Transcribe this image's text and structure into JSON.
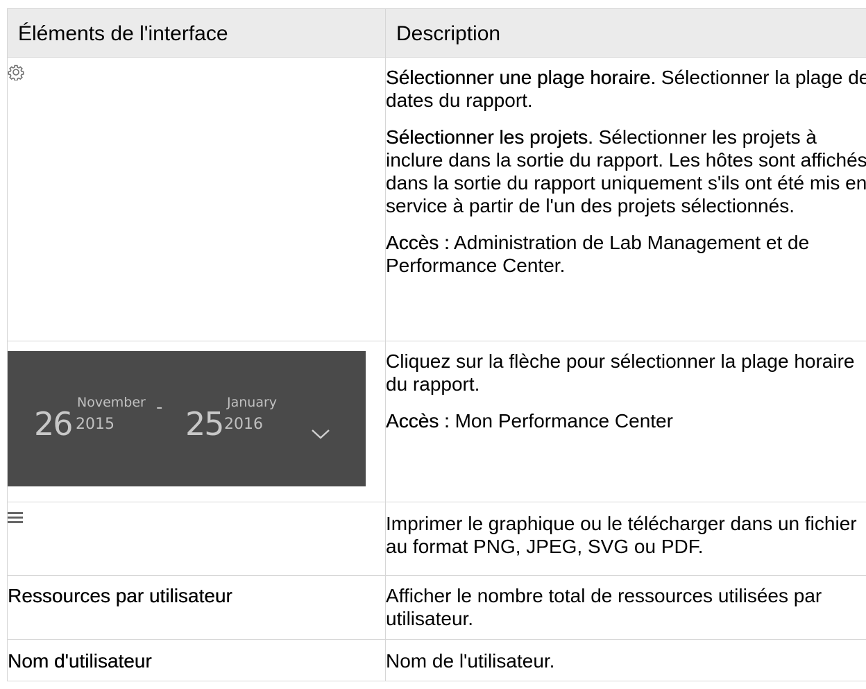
{
  "table": {
    "headers": {
      "col1": "Éléments de l'interface",
      "col2": "Description"
    },
    "rows": [
      {
        "element_icon": "gear-icon",
        "paragraphs": [
          {
            "bold": "Sélectionner une plage horaire.",
            "text": " Sélectionner la plage de dates du rapport."
          },
          {
            "bold": "Sélectionner les projets.",
            "text": " Sélectionner les projets à inclure dans la sortie du rapport. Les hôtes sont affichés dans la sortie du rapport uniquement s'ils ont été mis en service à partir de l'un des projets sélectionnés."
          },
          {
            "bold": "Accès :",
            "text": " Administration de Lab Management et de Performance Center."
          }
        ]
      },
      {
        "date_range": {
          "start_day": "26",
          "start_month": "November",
          "start_year": "2015",
          "separator": "-",
          "end_day": "25",
          "end_month": "January",
          "end_year": "2016",
          "icon": "chevron-down-icon"
        },
        "paragraphs": [
          {
            "bold": "",
            "text": "Cliquez sur la flèche pour sélectionner la plage horaire du rapport."
          },
          {
            "bold": "Accès :",
            "text": " Mon Performance Center"
          }
        ]
      },
      {
        "element_icon": "menu-icon",
        "paragraphs": [
          {
            "bold": "",
            "text": "Imprimer le graphique ou le télécharger dans un fichier au format PNG, JPEG, SVG ou PDF."
          }
        ]
      },
      {
        "element_label": "Ressources par utilisateur",
        "paragraphs": [
          {
            "bold": "",
            "text": "Afficher le nombre total de ressources utilisées par utilisateur."
          }
        ]
      },
      {
        "element_label": "Nom d'utilisateur",
        "paragraphs": [
          {
            "bold": "",
            "text": "Nom de l'utilisateur."
          }
        ]
      }
    ]
  },
  "colors": {
    "header_bg": "#ebebeb",
    "border": "#d6d6d6",
    "widget_bg": "#4a4a4a",
    "widget_text": "#c8c8c8"
  }
}
